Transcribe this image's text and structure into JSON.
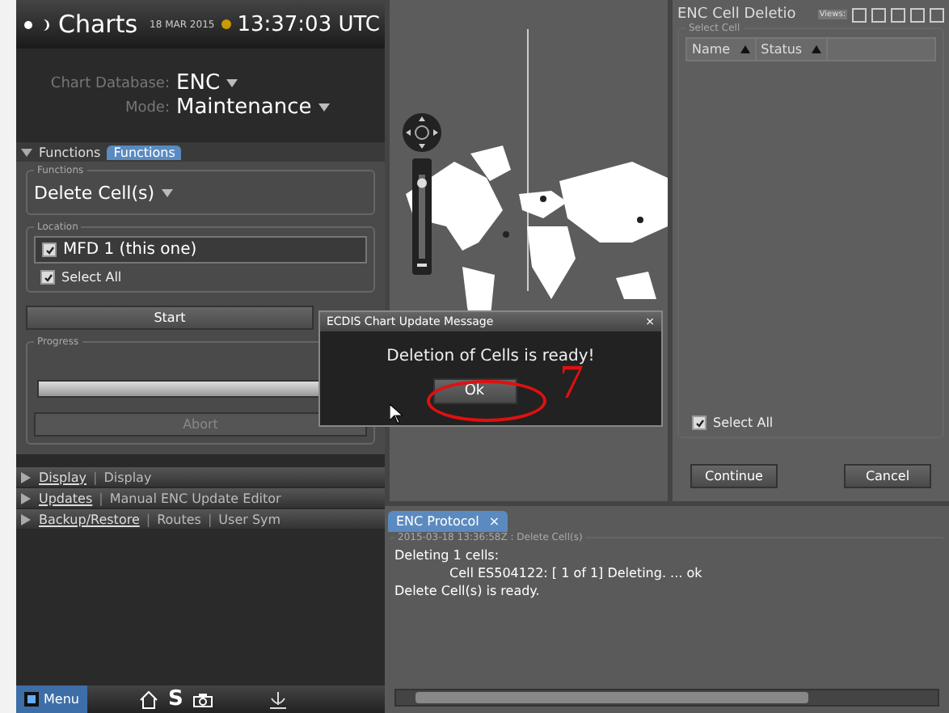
{
  "header": {
    "title": "Charts",
    "date": "18 MAR 2015",
    "time": "13:37:03 UTC"
  },
  "settings": [
    {
      "label": "Chart Database:",
      "value": "ENC"
    },
    {
      "label": "Mode:",
      "value": "Maintenance"
    }
  ],
  "functions_panel": {
    "title": "Functions",
    "expanded": true,
    "tabs": [
      {
        "label": "Functions",
        "selected": true
      }
    ]
  },
  "function_group": {
    "legend": "Functions",
    "value": "Delete Cell(s)"
  },
  "location": {
    "legend": "Location",
    "items": [
      {
        "label": "MFD 1 (this one)",
        "checked": true
      }
    ],
    "select_all": {
      "label": "Select All",
      "checked": true
    }
  },
  "start_button": "Start",
  "progress": {
    "legend": "Progress",
    "level": 1,
    "abort": {
      "label": "Abort",
      "disabled": true
    }
  },
  "sections": [
    {
      "title": "Display",
      "separator": "|",
      "links": [
        "Display"
      ],
      "expanded": false
    },
    {
      "title": "Updates",
      "separator": "|",
      "links": [
        "Manual ENC Update Editor"
      ],
      "expanded": false
    },
    {
      "title": "Backup/Restore",
      "separator": "|",
      "links": [
        "Routes",
        "User Sym"
      ],
      "expanded": false
    }
  ],
  "map_controls": {
    "zoom": {
      "level": 0.9
    }
  },
  "taskbar": {
    "menu": "Menu",
    "s_label": "S"
  },
  "right_panel": {
    "title": "ENC Cell Deletio",
    "views_label": "Views:",
    "group": "Select Cell",
    "columns": [
      "Name",
      "Status"
    ],
    "select_all": {
      "label": "Select All",
      "checked": true
    },
    "buttons": [
      "Continue",
      "Cancel"
    ]
  },
  "protocol": {
    "tab": {
      "label": "ENC Protocol",
      "close": "×",
      "selected": true
    },
    "legend": "2015-03-18 13:36:58Z : Delete Cell(s)",
    "lines": [
      {
        "kind": "line",
        "text": "Deleting 1 cells:"
      },
      {
        "kind": "detail",
        "text": "Cell ES504122: [ 1 of  1] Deleting. ... ok"
      },
      {
        "kind": "line",
        "text": "Delete Cell(s) is ready."
      }
    ]
  },
  "dialog": {
    "title": "ECDIS Chart Update Message",
    "close": "×",
    "message": "Deletion of Cells is ready!",
    "button": "Ok"
  },
  "annotation": {
    "number": "7"
  }
}
